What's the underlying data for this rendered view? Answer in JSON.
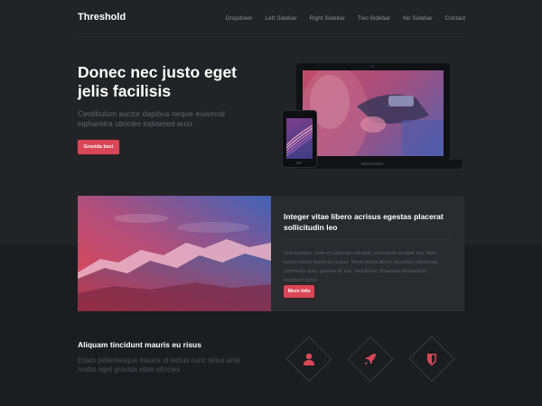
{
  "brand": "Threshold",
  "nav": [
    "Dropdown",
    "Left Sidebar",
    "Right Sidebar",
    "Two Sidebar",
    "No Sidebar",
    "Contact"
  ],
  "hero": {
    "title": "Donec nec justo eget jelis facilisis",
    "subtitle": "Cestibulum auctor dapibus neque euismod inpharetra ultricies indiamed arcu",
    "button": "Gravida beci"
  },
  "feature": {
    "title": "Integer vitae libero acrisus egestas placerat sollicitudin leo",
    "text": "Sed egestas, ante et vulputate volutpat, eros pede semper est, vitae luctus metus libero eu augue. Morbi purus libero, faucibus adipiscing, commodo quis, gravida id, est. Sed lectus. Praesent elementum hendrerit tortor.",
    "button": "More Info"
  },
  "bottom": {
    "title": "Aliquam tincidunt mauris eu risus",
    "text": "Etiam pellentesque mauris ut lectus nunc tellus ante mattis eget gravida vitae ultricies"
  },
  "icons": [
    "user-icon",
    "rocket-icon",
    "shield-icon"
  ],
  "colors": {
    "accent": "#d94655",
    "background": "#222326",
    "card": "#2a2b2f"
  }
}
